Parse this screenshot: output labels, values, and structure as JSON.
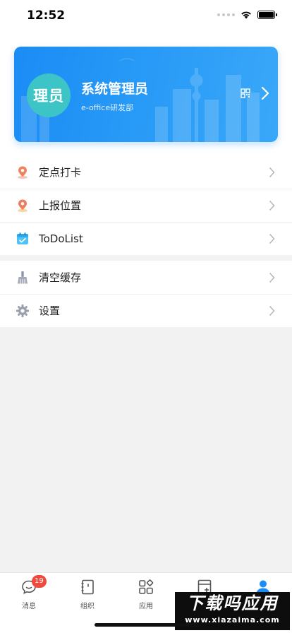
{
  "status_bar": {
    "time": "12:52"
  },
  "profile": {
    "avatar_text": "理员",
    "name": "系统管理员",
    "department": "e-office研发部",
    "colors": {
      "card": "#1a8cf5",
      "avatar": "#3dc4c6"
    }
  },
  "menu": {
    "group1": [
      {
        "label": "定点打卡",
        "icon": "location-pin-icon"
      },
      {
        "label": "上报位置",
        "icon": "location-report-icon"
      },
      {
        "label": "ToDoList",
        "icon": "calendar-todo-icon"
      }
    ],
    "group2": [
      {
        "label": "清空缓存",
        "icon": "broom-icon"
      },
      {
        "label": "设置",
        "icon": "gear-icon"
      }
    ]
  },
  "tabbar": {
    "items": [
      {
        "label": "消息",
        "icon": "chat-bubble-icon",
        "badge": "19"
      },
      {
        "label": "组织",
        "icon": "notebook-icon"
      },
      {
        "label": "应用",
        "icon": "apps-grid-icon"
      },
      {
        "label": "",
        "icon": "add-document-icon"
      },
      {
        "label": "",
        "icon": "person-icon",
        "active": true
      }
    ],
    "active_color": "#1a8cf5"
  },
  "watermark": {
    "title": "下载吗应用",
    "url": "www.xiazaima.com"
  }
}
